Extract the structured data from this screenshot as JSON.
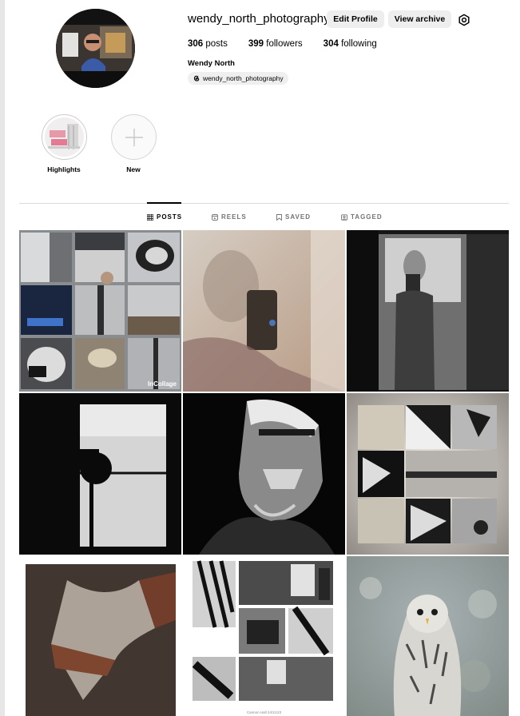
{
  "profile": {
    "username": "wendy_north_photography",
    "edit_profile_label": "Edit Profile",
    "view_archive_label": "View archive",
    "posts_count": "306",
    "posts_label": "posts",
    "followers_count": "399",
    "followers_label": "followers",
    "following_count": "304",
    "following_label": "following",
    "full_name": "Wendy North",
    "threads_handle": "wendy_north_photography"
  },
  "highlights": [
    {
      "label": "Highlights"
    },
    {
      "label": "New"
    }
  ],
  "tabs": [
    {
      "label": "POSTS",
      "icon": "grid-icon",
      "active": true
    },
    {
      "label": "REELS",
      "icon": "reels-icon",
      "active": false
    },
    {
      "label": "SAVED",
      "icon": "bookmark-icon",
      "active": false
    },
    {
      "label": "TAGGED",
      "icon": "tag-icon",
      "active": false
    }
  ],
  "posts": {
    "collage_watermark": "InCollage",
    "diner_caption": "Cannon Hall 24/11/23"
  },
  "colors": {
    "divider": "#dbdbdb",
    "button_bg": "#eeeeee",
    "page_bg": "#e6e6e6"
  }
}
